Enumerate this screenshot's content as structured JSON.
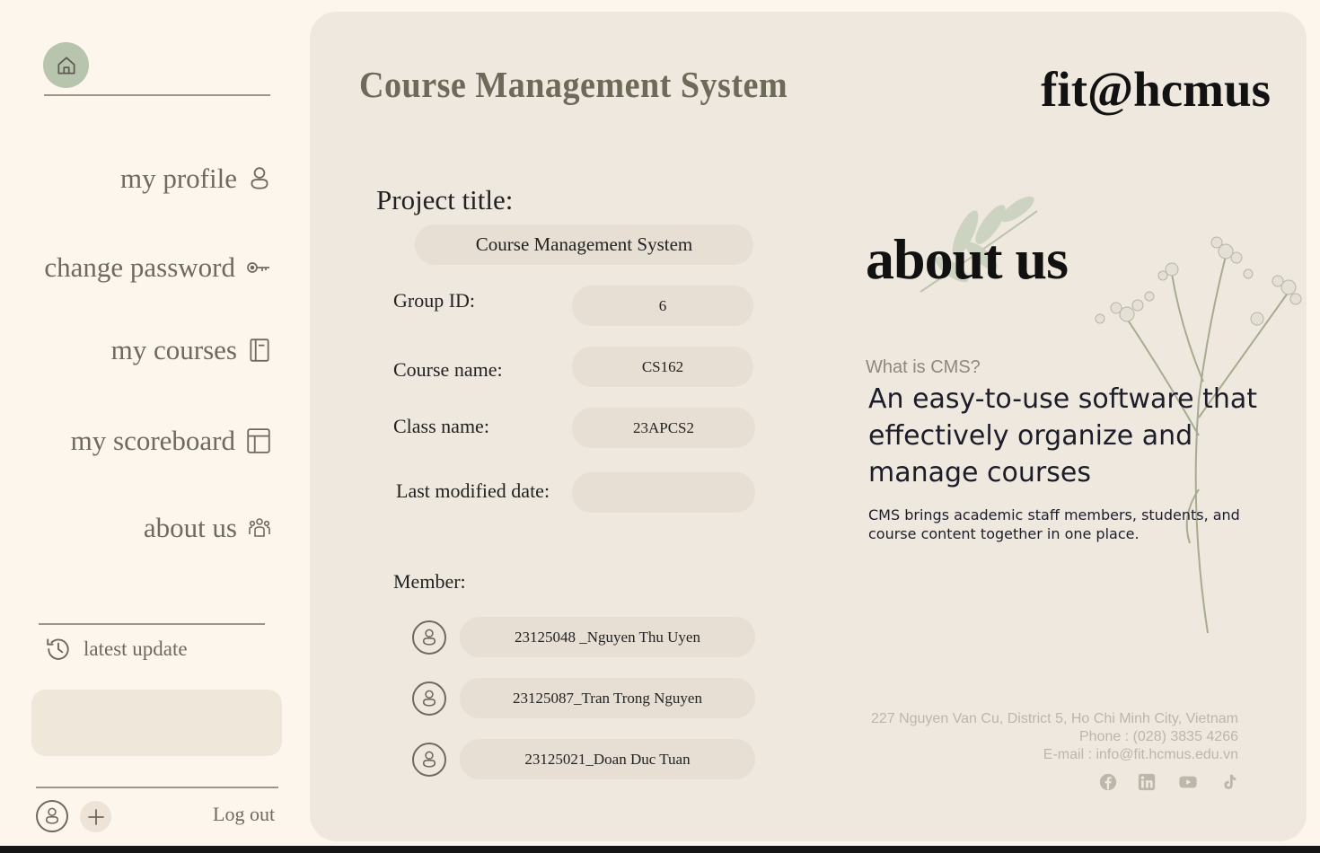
{
  "sidebar": {
    "nav": [
      {
        "label": "my profile",
        "icon": "user-icon"
      },
      {
        "label": "change password",
        "icon": "key-icon"
      },
      {
        "label": "my courses",
        "icon": "notebook-icon"
      },
      {
        "label": "my scoreboard",
        "icon": "table-icon"
      },
      {
        "label": "about us",
        "icon": "team-icon"
      }
    ],
    "latest_update_label": "latest update",
    "logout_label": "Log out"
  },
  "header": {
    "app_title": "Course Management System",
    "brand": "fit@hcmus"
  },
  "project": {
    "title_label": "Project title:",
    "title_value": "Course Management System",
    "group_id_label": "Group ID:",
    "group_id_value": "6",
    "course_name_label": "Course name:",
    "course_name_value": "CS162",
    "class_name_label": "Class name:",
    "class_name_value": "23APCS2",
    "last_modified_label": "Last modified date:",
    "last_modified_value": "",
    "member_label": "Member:",
    "members": [
      "23125048 _Nguyen Thu Uyen",
      "23125087_Tran Trong Nguyen",
      "23125021_Doan Duc Tuan"
    ]
  },
  "about": {
    "heading": "about us",
    "question": "What is CMS?",
    "tagline": "An easy-to-use software that effectively organize and manage courses",
    "description": "CMS brings academic staff members, students, and course content together in one place.",
    "address": "227 Nguyen Van Cu, District 5, Ho Chi Minh City, Vietnam",
    "phone": "Phone : (028) 3835 4266",
    "email": "E-mail : info@fit.hcmus.edu.vn",
    "social_icons": [
      "facebook-icon",
      "linkedin-icon",
      "youtube-icon",
      "tiktok-icon"
    ]
  },
  "colors": {
    "page_bg": "#FCF6EC",
    "panel_bg": "#EFE8DE",
    "pill_bg": "#E7DFD3",
    "home_button": "#B7C4AE",
    "muted_text": "#6E6A5F"
  }
}
